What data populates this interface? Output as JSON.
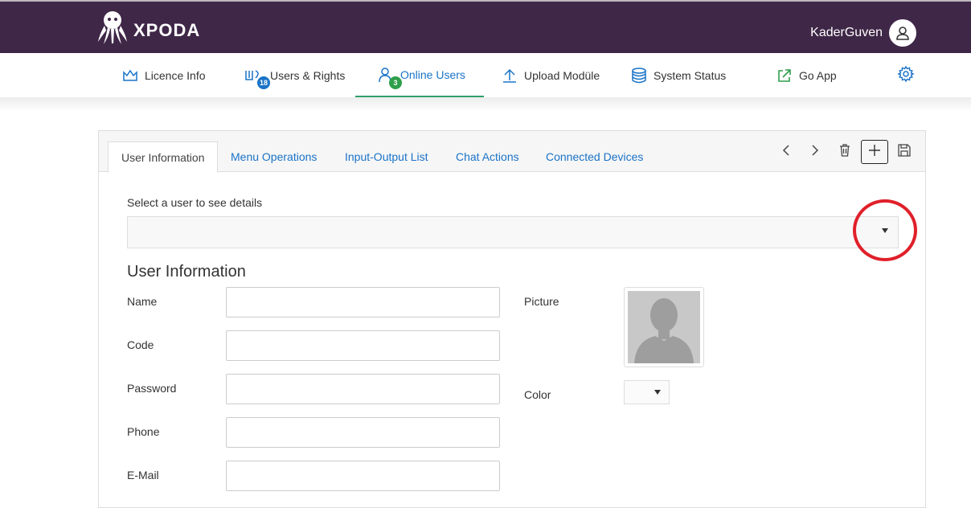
{
  "header": {
    "logo_text": "XPODA",
    "username": "KaderGuven"
  },
  "nav": {
    "items": [
      {
        "label": "Licence Info",
        "icon": "crown-icon"
      },
      {
        "label": "Users & Rights",
        "icon": "users-rights-icon",
        "badge": "18"
      },
      {
        "label": "Online Users",
        "icon": "online-user-icon",
        "badge": "3",
        "active": true
      },
      {
        "label": "Upload Modüle",
        "icon": "upload-icon"
      },
      {
        "label": "System Status",
        "icon": "database-icon"
      },
      {
        "label": "Go App",
        "icon": "external-link-icon"
      }
    ],
    "settings_icon": "gear-icon"
  },
  "tabs": [
    {
      "label": "User Information",
      "active": true
    },
    {
      "label": "Menu Operations"
    },
    {
      "label": "Input-Output List"
    },
    {
      "label": "Chat Actions"
    },
    {
      "label": "Connected Devices"
    }
  ],
  "toolbar": {
    "icons": [
      "chevron-left-icon",
      "chevron-right-icon",
      "trash-icon",
      "plus-icon",
      "save-icon"
    ]
  },
  "form": {
    "select_label": "Select a user to see details",
    "select_value": "",
    "section_title": "User Information",
    "fields": [
      {
        "label": "Name",
        "value": ""
      },
      {
        "label": "Code",
        "value": ""
      },
      {
        "label": "Password",
        "value": ""
      },
      {
        "label": "Phone",
        "value": ""
      },
      {
        "label": "E-Mail",
        "value": ""
      }
    ],
    "picture_label": "Picture",
    "color_label": "Color",
    "color_value": ""
  },
  "colors": {
    "header_bg": "#3f2748",
    "accent_blue": "#1a73c8",
    "accent_green": "#2e9f4a",
    "highlight_ring": "#e0202a"
  }
}
